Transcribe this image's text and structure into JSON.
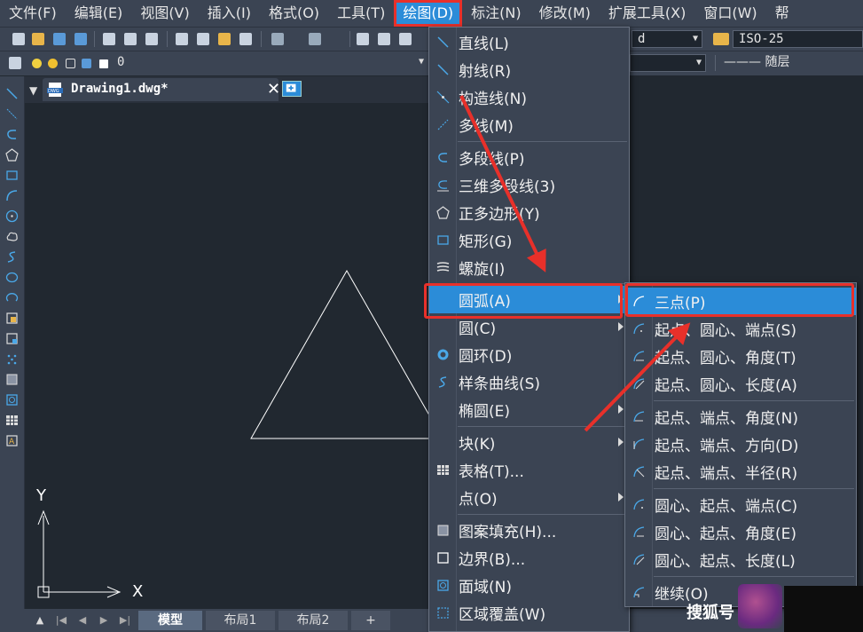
{
  "menubar": {
    "items": [
      "文件(F)",
      "编辑(E)",
      "视图(V)",
      "插入(I)",
      "格式(O)",
      "工具(T)",
      "绘图(D)",
      "标注(N)",
      "修改(M)",
      "扩展工具(X)",
      "窗口(W)",
      "帮"
    ]
  },
  "toolbar": {
    "layer_value": "0",
    "style_value": "d",
    "dimstyle_value": "ISO-25",
    "linetype_value": "——— 随层"
  },
  "document": {
    "tab_title": "Drawing1.dwg*"
  },
  "draw_menu": {
    "items": [
      {
        "label": "直线(L)",
        "icon": "line-icon"
      },
      {
        "label": "射线(R)",
        "icon": "ray-icon"
      },
      {
        "label": "构造线(N)",
        "icon": "construction-line-icon"
      },
      {
        "label": "多线(M)",
        "icon": "multiline-icon"
      },
      {
        "label": "多段线(P)",
        "icon": "polyline-icon"
      },
      {
        "label": "三维多段线(3)",
        "icon": "3d-polyline-icon"
      },
      {
        "label": "正多边形(Y)",
        "icon": "polygon-icon"
      },
      {
        "label": "矩形(G)",
        "icon": "rectangle-icon"
      },
      {
        "label": "螺旋(I)",
        "icon": "helix-icon"
      },
      {
        "label": "圆弧(A)",
        "icon": "",
        "submenu": true
      },
      {
        "label": "圆(C)",
        "icon": "",
        "submenu": true
      },
      {
        "label": "圆环(D)",
        "icon": "donut-icon"
      },
      {
        "label": "样条曲线(S)",
        "icon": "spline-icon"
      },
      {
        "label": "椭圆(E)",
        "icon": "",
        "submenu": true
      },
      {
        "label": "块(K)",
        "icon": "",
        "submenu": true
      },
      {
        "label": "表格(T)...",
        "icon": "table-icon"
      },
      {
        "label": "点(O)",
        "icon": "",
        "submenu": true
      },
      {
        "label": "图案填充(H)...",
        "icon": "hatch-icon"
      },
      {
        "label": "边界(B)...",
        "icon": "boundary-icon"
      },
      {
        "label": "面域(N)",
        "icon": "region-icon"
      },
      {
        "label": "区域覆盖(W)",
        "icon": "wipeout-icon"
      }
    ]
  },
  "arc_submenu": {
    "items": [
      "三点(P)",
      "起点、圆心、端点(S)",
      "起点、圆心、角度(T)",
      "起点、圆心、长度(A)",
      "起点、端点、角度(N)",
      "起点、端点、方向(D)",
      "起点、端点、半径(R)",
      "圆心、起点、端点(C)",
      "圆心、起点、角度(E)",
      "圆心、起点、长度(L)",
      "继续(O)"
    ]
  },
  "layout_tabs": [
    "模型",
    "布局1",
    "布局2",
    "+"
  ],
  "ucs": {
    "x_label": "X",
    "y_label": "Y"
  },
  "watermark": "搜狐号",
  "colors": {
    "accent": "#2b8cd8",
    "highlight_box": "#e8302a",
    "background": "#212830"
  }
}
